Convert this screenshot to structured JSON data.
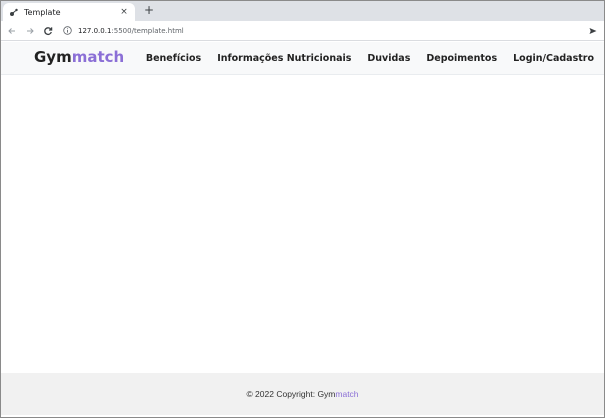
{
  "browser": {
    "tab_title": "Template",
    "tab_close": "×",
    "new_tab": "+",
    "url_host": "127.0.0.1",
    "url_path": ":5500/template.html"
  },
  "navbar": {
    "brand_main": "Gym",
    "brand_accent": "match",
    "links": [
      "Benefícios",
      "Informações Nutricionais",
      "Duvidas",
      "Depoimentos",
      "Login/Cadastro"
    ]
  },
  "footer": {
    "prefix": "© 2022 Copyright: ",
    "brand_main": "Gym",
    "brand_accent": "match"
  },
  "colors": {
    "accent": "#8b6fd6",
    "navbar_bg": "#f8f9fa",
    "footer_bg": "#f1f1f1"
  }
}
